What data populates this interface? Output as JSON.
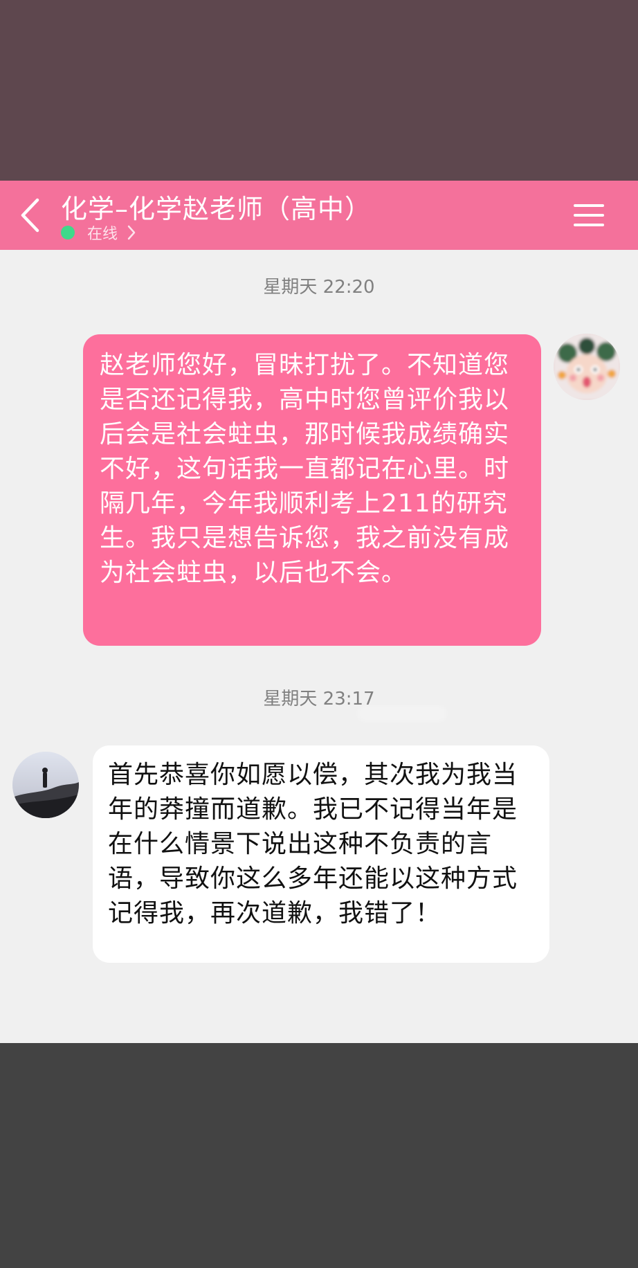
{
  "header": {
    "title": "化学–化学赵老师（高中）",
    "status": "在线",
    "accent_color": "#f4719b",
    "back_icon": "chevron-left-icon",
    "menu_icon": "hamburger-menu-icon"
  },
  "messages": [
    {
      "timestamp": "星期天 22:20",
      "direction": "outgoing",
      "text": "赵老师您好，冒昧打扰了。不知道您是否还记得我，高中时您曾评价我以后会是社会蛀虫，那时候我成绩确实不好，这句话我一直都记在心里。时隔几年，今年我顺利考上211的研究生。我只是想告诉您，我之前没有成为社会蛀虫，以后也不会。",
      "bubble_color": "#fd6f9c"
    },
    {
      "timestamp": "星期天 23:17",
      "direction": "incoming",
      "text": "首先恭喜你如愿以偿，其次我为我当年的莽撞而道歉。我已不记得当年是在什么情景下说出这种不负责的言语，导致你这么多年还能以这种方式记得我，再次道歉，我错了！",
      "bubble_color": "#ffffff"
    }
  ]
}
